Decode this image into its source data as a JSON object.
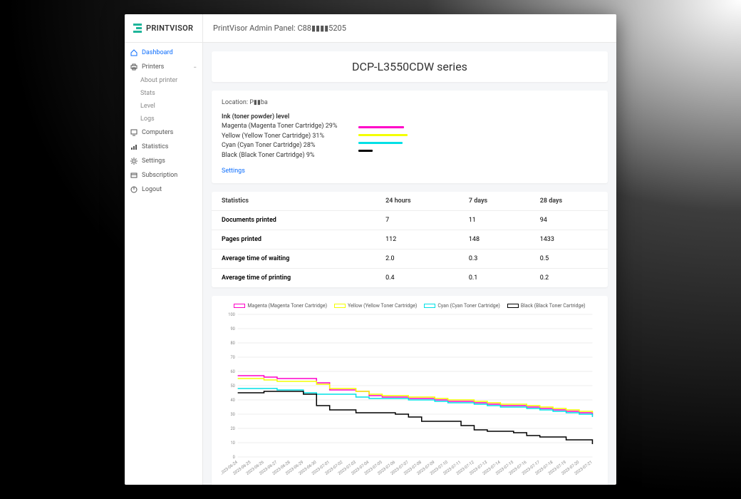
{
  "brand": "PRINTVISOR",
  "app_title": "PrintVisor Admin Panel: C88▮▮▮▮5205",
  "sidebar": {
    "dashboard": "Dashboard",
    "printers": "Printers",
    "printers_sub": [
      "About printer",
      "Stats",
      "Level",
      "Logs"
    ],
    "computers": "Computers",
    "statistics": "Statistics",
    "settings": "Settings",
    "subscription": "Subscription",
    "logout": "Logout"
  },
  "page_title": "DCP-L3550CDW series",
  "location_label": "Location: P▮▮ba",
  "ink_title": "Ink (toner powder) level",
  "ink": [
    {
      "label": "Magenta (Magenta Toner Cartridge) 29%",
      "pct": 29,
      "color": "#ff00c8"
    },
    {
      "label": "Yellow (Yellow Toner Cartridge) 31%",
      "pct": 31,
      "color": "#f3ff00"
    },
    {
      "label": "Cyan (Cyan Toner Cartridge) 28%",
      "pct": 28,
      "color": "#00e0e6"
    },
    {
      "label": "Black (Black Toner Cartridge) 9%",
      "pct": 9,
      "color": "#000000"
    }
  ],
  "settings_link": "Settings",
  "stats_header": [
    "Statistics",
    "24 hours",
    "7 days",
    "28 days"
  ],
  "stats_rows": [
    {
      "label": "Documents printed",
      "v": [
        "7",
        "11",
        "94"
      ]
    },
    {
      "label": "Pages printed",
      "v": [
        "112",
        "148",
        "1433"
      ]
    },
    {
      "label": "Average time of waiting",
      "v": [
        "2.0",
        "0.3",
        "0.5"
      ]
    },
    {
      "label": "Average time of printing",
      "v": [
        "0.4",
        "0.1",
        "0.2"
      ]
    }
  ],
  "chart_data": {
    "type": "line",
    "title": "",
    "xlabel": "",
    "ylabel": "",
    "ylim": [
      0,
      100
    ],
    "yticks": [
      0,
      10,
      20,
      30,
      40,
      50,
      60,
      70,
      80,
      90,
      100
    ],
    "categories": [
      "2023-06-24",
      "2023-06-25",
      "2023-06-26",
      "2023-06-27",
      "2023-06-28",
      "2023-06-29",
      "2023-06-30",
      "2023-07-01",
      "2023-07-02",
      "2023-07-03",
      "2023-07-04",
      "2023-07-05",
      "2023-07-06",
      "2023-07-07",
      "2023-07-08",
      "2023-07-09",
      "2023-07-10",
      "2023-07-11",
      "2023-07-12",
      "2023-07-13",
      "2023-07-14",
      "2023-07-15",
      "2023-07-16",
      "2023-07-17",
      "2023-07-18",
      "2023-07-19",
      "2023-07-20",
      "2023-07-21"
    ],
    "series": [
      {
        "name": "Magenta (Magenta Toner Cartridge)",
        "color": "#ff00c8",
        "values": [
          57,
          57,
          56,
          55,
          55,
          55,
          52,
          47,
          47,
          46,
          43,
          42,
          42,
          41,
          41,
          40,
          39,
          39,
          38,
          37,
          36,
          36,
          35,
          34,
          33,
          32,
          31,
          29
        ]
      },
      {
        "name": "Yellow (Yellow Toner Cartridge)",
        "color": "#f3ff00",
        "values": [
          55,
          55,
          54,
          53,
          53,
          53,
          51,
          48,
          48,
          46,
          44,
          43,
          43,
          42,
          42,
          41,
          40,
          40,
          39,
          38,
          37,
          37,
          36,
          35,
          34,
          33,
          32,
          31
        ]
      },
      {
        "name": "Cyan (Cyan Toner Cartridge)",
        "color": "#00e0e6",
        "values": [
          48,
          48,
          48,
          47,
          47,
          45,
          44,
          44,
          44,
          42,
          41,
          41,
          41,
          40,
          40,
          39,
          38,
          38,
          37,
          36,
          35,
          35,
          34,
          33,
          32,
          31,
          30,
          28
        ]
      },
      {
        "name": "Black (Black Toner Cartridge)",
        "color": "#000000",
        "values": [
          45,
          45,
          46,
          46,
          46,
          44,
          36,
          33,
          33,
          31,
          31,
          31,
          30,
          28,
          25,
          25,
          25,
          22,
          19,
          18,
          18,
          17,
          15,
          14,
          14,
          12,
          12,
          9
        ]
      }
    ]
  }
}
